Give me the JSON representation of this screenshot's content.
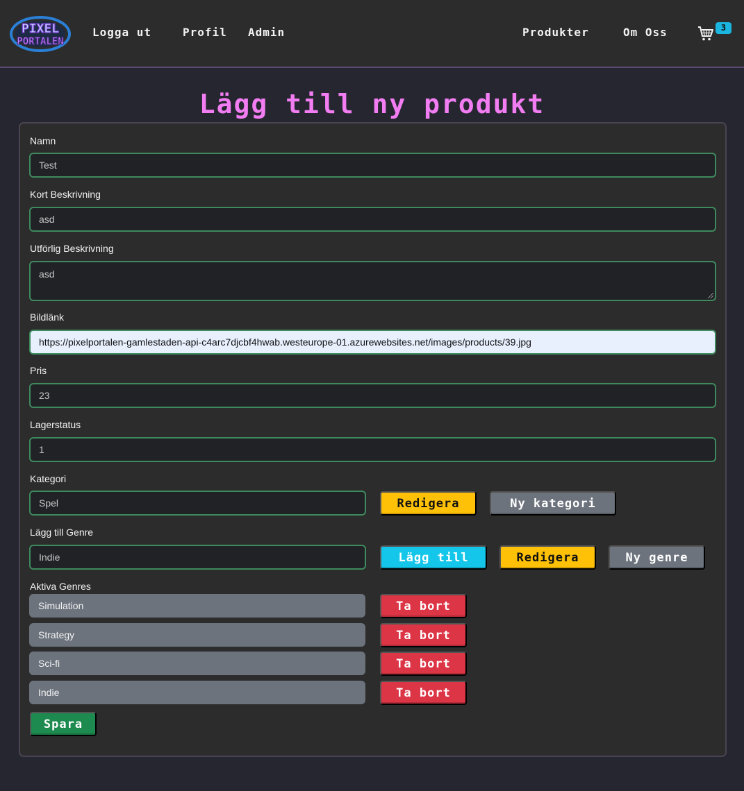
{
  "nav": {
    "logo_top": "PIXEL",
    "logo_bottom": "PORTALEN",
    "left_links": [
      "Logga ut",
      "Profil",
      "Admin"
    ],
    "right_links": [
      "Produkter",
      "Om Oss"
    ],
    "cart_icon": "shopping-cart-icon",
    "cart_count": "3"
  },
  "page": {
    "title": "Lägg till ny produkt"
  },
  "form": {
    "name": {
      "label": "Namn",
      "value": "Test"
    },
    "short_desc": {
      "label": "Kort Beskrivning",
      "value": "asd"
    },
    "long_desc": {
      "label": "Utförlig Beskrivning",
      "value": "asd"
    },
    "image": {
      "label": "Bildlänk",
      "value": "https://pixelportalen-gamlestaden-api-c4arc7djcbf4hwab.westeurope-01.azurewebsites.net/images/products/39.jpg"
    },
    "price": {
      "label": "Pris",
      "value": "23"
    },
    "stock": {
      "label": "Lagerstatus",
      "value": "1"
    },
    "category": {
      "label": "Kategori",
      "value": "Spel",
      "edit_label": "Redigera",
      "new_label": "Ny kategori"
    },
    "genre": {
      "label": "Lägg till Genre",
      "value": "Indie",
      "add_label": "Lägg till",
      "edit_label": "Redigera",
      "new_label": "Ny genre"
    },
    "active_genres": {
      "label": "Aktiva Genres",
      "remove_label": "Ta bort",
      "items": [
        "Simulation",
        "Strategy",
        "Sci-fi",
        "Indie"
      ]
    },
    "save_label": "Spara"
  },
  "colors": {
    "title": "#f27df2",
    "field_border": "#3e8a5e",
    "warning": "#ffc107",
    "info": "#14c6ea",
    "danger": "#dc3545",
    "success": "#1d8a4f",
    "secondary": "#6c737d"
  }
}
